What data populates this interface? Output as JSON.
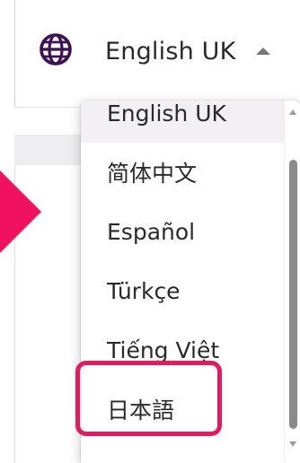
{
  "language_selector": {
    "current_language": "English UK",
    "icon": "globe-icon",
    "caret_icon": "caret-up-icon"
  },
  "dropdown": {
    "items": [
      {
        "label": "English UK",
        "selected": true
      },
      {
        "label": "简体中文",
        "selected": false
      },
      {
        "label": "Español",
        "selected": false
      },
      {
        "label": "Türkçe",
        "selected": false
      },
      {
        "label": "Tiếng Việt",
        "selected": false
      },
      {
        "label": "日本語",
        "selected": false
      }
    ]
  },
  "annotation": {
    "highlighted_item": "日本語",
    "highlight_color": "#e6195f",
    "arrow_color": "#f0125f"
  },
  "colors": {
    "globe": "#3d1152",
    "text": "#2a2a2a",
    "selected_bg": "#f2f0f5"
  }
}
